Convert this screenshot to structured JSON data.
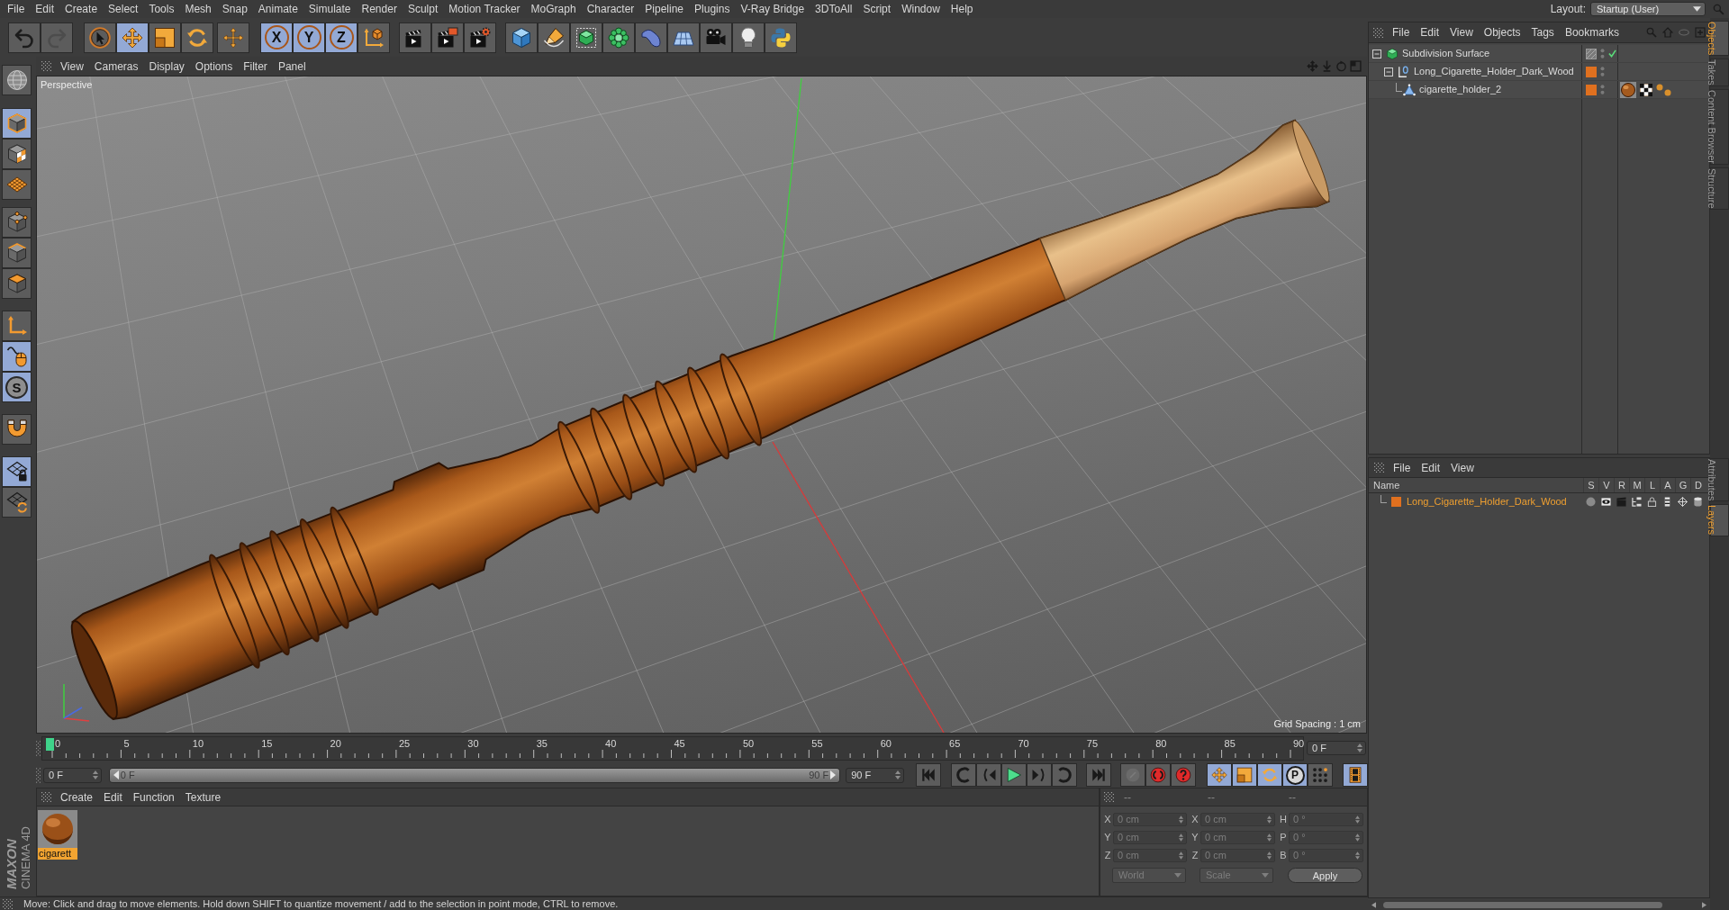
{
  "menu_bar": {
    "items": [
      "File",
      "Edit",
      "Create",
      "Select",
      "Tools",
      "Mesh",
      "Snap",
      "Animate",
      "Simulate",
      "Render",
      "Sculpt",
      "Motion Tracker",
      "MoGraph",
      "Character",
      "Pipeline",
      "Plugins",
      "V-Ray Bridge",
      "3DToAll",
      "Script",
      "Window",
      "Help"
    ],
    "layout_label": "Layout:",
    "layout_value": "Startup (User)"
  },
  "toolbar": [
    {
      "items": [
        {
          "kind": "undo",
          "disabled": false
        },
        {
          "kind": "redo",
          "disabled": true
        }
      ]
    },
    {
      "items": [
        {
          "kind": "select",
          "selected": false
        },
        {
          "kind": "move",
          "selected": true
        },
        {
          "kind": "scale",
          "selected": false
        },
        {
          "kind": "rotate",
          "selected": false
        }
      ]
    },
    {
      "items": [
        {
          "kind": "add",
          "selected": false
        }
      ]
    },
    {
      "items": [
        {
          "kind": "axis",
          "label": "X",
          "selected": true
        },
        {
          "kind": "axis",
          "label": "Y",
          "selected": true
        },
        {
          "kind": "axis",
          "label": "Z",
          "selected": true
        },
        {
          "kind": "coords",
          "selected": false
        }
      ]
    },
    {
      "items": [
        {
          "kind": "renderview",
          "selected": false
        },
        {
          "kind": "renderpicture",
          "selected": false
        },
        {
          "kind": "rendersettings",
          "selected": false
        }
      ]
    },
    {
      "items": [
        {
          "kind": "cube",
          "selected": false
        },
        {
          "kind": "pen",
          "selected": false
        },
        {
          "kind": "subdivision",
          "selected": false
        },
        {
          "kind": "cloner",
          "selected": false
        },
        {
          "kind": "bend",
          "selected": false
        },
        {
          "kind": "floor",
          "selected": false
        },
        {
          "kind": "camera",
          "selected": false
        },
        {
          "kind": "light",
          "selected": false
        },
        {
          "kind": "python",
          "selected": false
        }
      ]
    }
  ],
  "mode_toolbar": [
    {
      "items": [
        {
          "kind": "editable",
          "selected": false
        }
      ]
    },
    {
      "items": [
        {
          "kind": "model",
          "selected": true
        },
        {
          "kind": "texture",
          "selected": false
        },
        {
          "kind": "workplane",
          "selected": false
        }
      ]
    },
    {
      "items": [
        {
          "kind": "points",
          "selected": false
        },
        {
          "kind": "edges",
          "selected": false
        },
        {
          "kind": "polygons",
          "selected": false
        }
      ]
    },
    {
      "items": [
        {
          "kind": "axismode",
          "selected": false
        },
        {
          "kind": "tweak",
          "selected": true
        },
        {
          "kind": "solo",
          "label": "S",
          "selected": true
        }
      ]
    },
    {
      "items": [
        {
          "kind": "snap",
          "selected": false
        }
      ]
    },
    {
      "items": [
        {
          "kind": "lock",
          "selected": true
        },
        {
          "kind": "grid",
          "selected": false
        }
      ]
    }
  ],
  "viewport": {
    "menu": [
      "View",
      "Cameras",
      "Display",
      "Options",
      "Filter",
      "Panel"
    ],
    "camera_label": "Perspective",
    "grid_spacing": "Grid Spacing : 1 cm"
  },
  "timeline": {
    "ticks": [
      "0",
      "5",
      "10",
      "15",
      "20",
      "25",
      "30",
      "35",
      "40",
      "45",
      "50",
      "55",
      "60",
      "65",
      "70",
      "75",
      "80",
      "85",
      "90"
    ],
    "playhead": {
      "level": 0
    },
    "current_frame": "0 F"
  },
  "frame_controls": {
    "start_field": "0 F",
    "range": {
      "start": "0 F",
      "end": "90 F",
      "level": 1
    },
    "end_field": "90 F",
    "groups": [
      {
        "items": [
          {
            "kind": "first"
          }
        ]
      },
      {
        "items": [
          {
            "kind": "prevkey"
          },
          {
            "kind": "prev"
          },
          {
            "kind": "play"
          },
          {
            "kind": "next"
          },
          {
            "kind": "nextkey"
          }
        ]
      },
      {
        "items": [
          {
            "kind": "last"
          }
        ]
      },
      {
        "items": [
          {
            "kind": "key",
            "disabled": true
          },
          {
            "kind": "record",
            "disabled": false
          },
          {
            "kind": "autokey",
            "disabled": false
          }
        ]
      },
      {
        "items": [
          {
            "kind": "pos",
            "selected": true
          },
          {
            "kind": "scl",
            "selected": true
          },
          {
            "kind": "rot",
            "selected": true
          },
          {
            "kind": "param",
            "label": "P",
            "selected": true
          },
          {
            "kind": "pla",
            "selected": false
          }
        ]
      },
      {
        "items": [
          {
            "kind": "film",
            "selected": true
          }
        ]
      }
    ]
  },
  "materials": {
    "menu": [
      "Create",
      "Edit",
      "Function",
      "Texture"
    ],
    "items": [
      {
        "name": "cigarett",
        "selected": true
      }
    ]
  },
  "coordinates": {
    "headers": [
      "--",
      "--",
      "--"
    ],
    "rows": [
      {
        "position_axis": "X",
        "position": "0 cm",
        "size_axis": "X",
        "size": "0 cm",
        "rotation_axis": "H",
        "rotation": "0 °"
      },
      {
        "position_axis": "Y",
        "position": "0 cm",
        "size_axis": "Y",
        "size": "0 cm",
        "rotation_axis": "P",
        "rotation": "0 °"
      },
      {
        "position_axis": "Z",
        "position": "0 cm",
        "size_axis": "Z",
        "size": "0 cm",
        "rotation_axis": "B",
        "rotation": "0 °"
      }
    ],
    "space": "World",
    "mode": "Scale",
    "apply": "Apply"
  },
  "status_bar": "Move: Click and drag to move elements. Hold down SHIFT to quantize movement / add to the selection in point mode, CTRL to remove.",
  "logo": {
    "brand": "MAXON",
    "product": "CINEMA 4D"
  },
  "objects": {
    "menu": [
      "File",
      "Edit",
      "View",
      "Objects",
      "Tags",
      "Bookmarks"
    ],
    "tree": [
      {
        "name": "Subdivision Surface",
        "kind": "generator",
        "expanded": true,
        "enabled": true,
        "children": [
          {
            "name": "Long_Cigarette_Holder_Dark_Wood",
            "kind": "null",
            "expanded": true,
            "color": "#e0701f",
            "children": [
              {
                "name": "cigarette_holder_2",
                "kind": "polygon",
                "color": "#e0701f",
                "tags": [
                  {
                    "kind": "material"
                  },
                  {
                    "kind": "texture"
                  },
                  {
                    "kind": "vertex"
                  }
                ]
              }
            ]
          }
        ]
      }
    ]
  },
  "layers": {
    "menu": [
      "File",
      "Edit",
      "View"
    ],
    "columns": [
      "Name",
      "S",
      "V",
      "R",
      "M",
      "L",
      "A",
      "G",
      "D"
    ],
    "items": [
      {
        "name": "Long_Cigarette_Holder_Dark_Wood",
        "color": "#e0701f",
        "selected": true
      }
    ]
  },
  "side_tabs": {
    "upper": [
      {
        "label": "Objects",
        "selected": true
      },
      {
        "label": "Takes",
        "selected": false
      },
      {
        "label": "Content Browser",
        "selected": false
      },
      {
        "label": "Structure",
        "selected": false
      }
    ],
    "lower": [
      {
        "label": "Attributes",
        "selected": false
      },
      {
        "label": "Layers",
        "selected": true
      }
    ]
  }
}
